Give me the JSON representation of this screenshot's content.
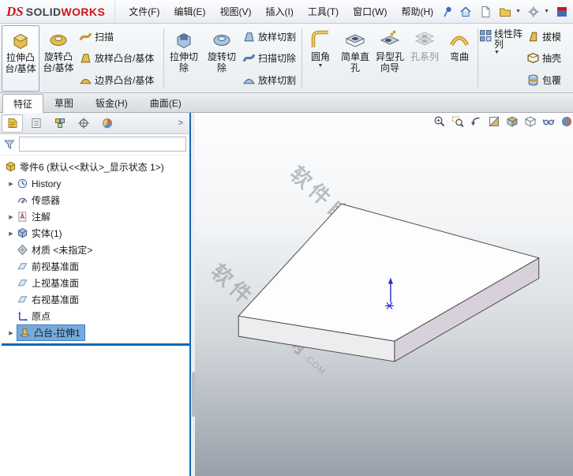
{
  "menubar": {
    "logo": {
      "ds": "DS",
      "solid": "SOLID",
      "works": "WORKS"
    },
    "menus": [
      "文件(F)",
      "编辑(E)",
      "视图(V)",
      "插入(I)",
      "工具(T)",
      "窗口(W)",
      "帮助(H)"
    ],
    "right_icons": [
      "pin-icon",
      "home-icon",
      "new-document-icon",
      "open-document-icon",
      "options-icon",
      "resources-icon"
    ]
  },
  "ribbon": {
    "extrude_boss": {
      "line1": "拉伸凸",
      "line2": "台/基体"
    },
    "revolve_boss": {
      "line1": "旋转凸",
      "line2": "台/基体"
    },
    "sweep": "扫描",
    "loft_boss": "放样凸台/基体",
    "boundary_boss": "边界凸台/基体",
    "extrude_cut": {
      "line1": "拉伸切",
      "line2": "除"
    },
    "revolve_cut": {
      "line1": "旋转切",
      "line2": "除"
    },
    "loft_cut": "放样切割",
    "sweep_cut": "扫描切除",
    "boundary_cut": "放样切割",
    "fillet": "圆角",
    "simple_hole": {
      "line1": "简单直",
      "line2": "孔"
    },
    "hole_wizard": {
      "line1": "异型孔",
      "line2": "向导"
    },
    "hole_series": "孔系列",
    "flex": "弯曲",
    "linear_pattern": {
      "line1": "线性阵",
      "line2": "列"
    },
    "draft": "拔模",
    "shell": "抽壳",
    "wrap": "包覆"
  },
  "tabs": [
    {
      "label": "特征",
      "active": true
    },
    {
      "label": "草图",
      "active": false
    },
    {
      "label": "钣金(H)",
      "active": false
    },
    {
      "label": "曲面(E)",
      "active": false
    }
  ],
  "panel_tabs": [
    "featuremanager-icon",
    "propertymanager-icon",
    "configurationmanager-icon",
    "dimxpertmanager-icon",
    "displaymanager-icon"
  ],
  "tree": {
    "root": "零件6 (默认<<默认>_显示状态 1>)",
    "items": [
      {
        "label": "History",
        "icon": "history-icon",
        "arrow": true,
        "selected": false
      },
      {
        "label": "传感器",
        "icon": "sensors-icon",
        "arrow": false,
        "selected": false
      },
      {
        "label": "注解",
        "icon": "annotations-icon",
        "arrow": true,
        "selected": false
      },
      {
        "label": "实体(1)",
        "icon": "solid-bodies-icon",
        "arrow": true,
        "selected": false
      },
      {
        "label": "材质 <未指定>",
        "icon": "material-icon",
        "arrow": false,
        "selected": false
      },
      {
        "label": "前视基准面",
        "icon": "plane-icon",
        "arrow": false,
        "selected": false
      },
      {
        "label": "上视基准面",
        "icon": "plane-icon",
        "arrow": false,
        "selected": false
      },
      {
        "label": "右视基准面",
        "icon": "plane-icon",
        "arrow": false,
        "selected": false
      },
      {
        "label": "原点",
        "icon": "origin-icon",
        "arrow": false,
        "selected": false
      },
      {
        "label": "凸台-拉伸1",
        "icon": "extrude-feature-icon",
        "arrow": true,
        "selected": true
      }
    ]
  },
  "viewport": {
    "hud_icons": [
      "zoom-fit-icon",
      "zoom-area-icon",
      "previous-view-icon",
      "section-view-icon",
      "view-orientation-icon",
      "display-style-icon",
      "hide-show-items-icon",
      "appearance-icon"
    ],
    "watermark": {
      "text": "软件自学网",
      "suffix": ".COM"
    }
  },
  "colors": {
    "brand_red": "#d1141c",
    "selection_blue": "#74aadc",
    "rollback_blue": "#1569b3",
    "origin_blue": "#2a2ad0",
    "watermark_gray": "#9aa0a8"
  }
}
